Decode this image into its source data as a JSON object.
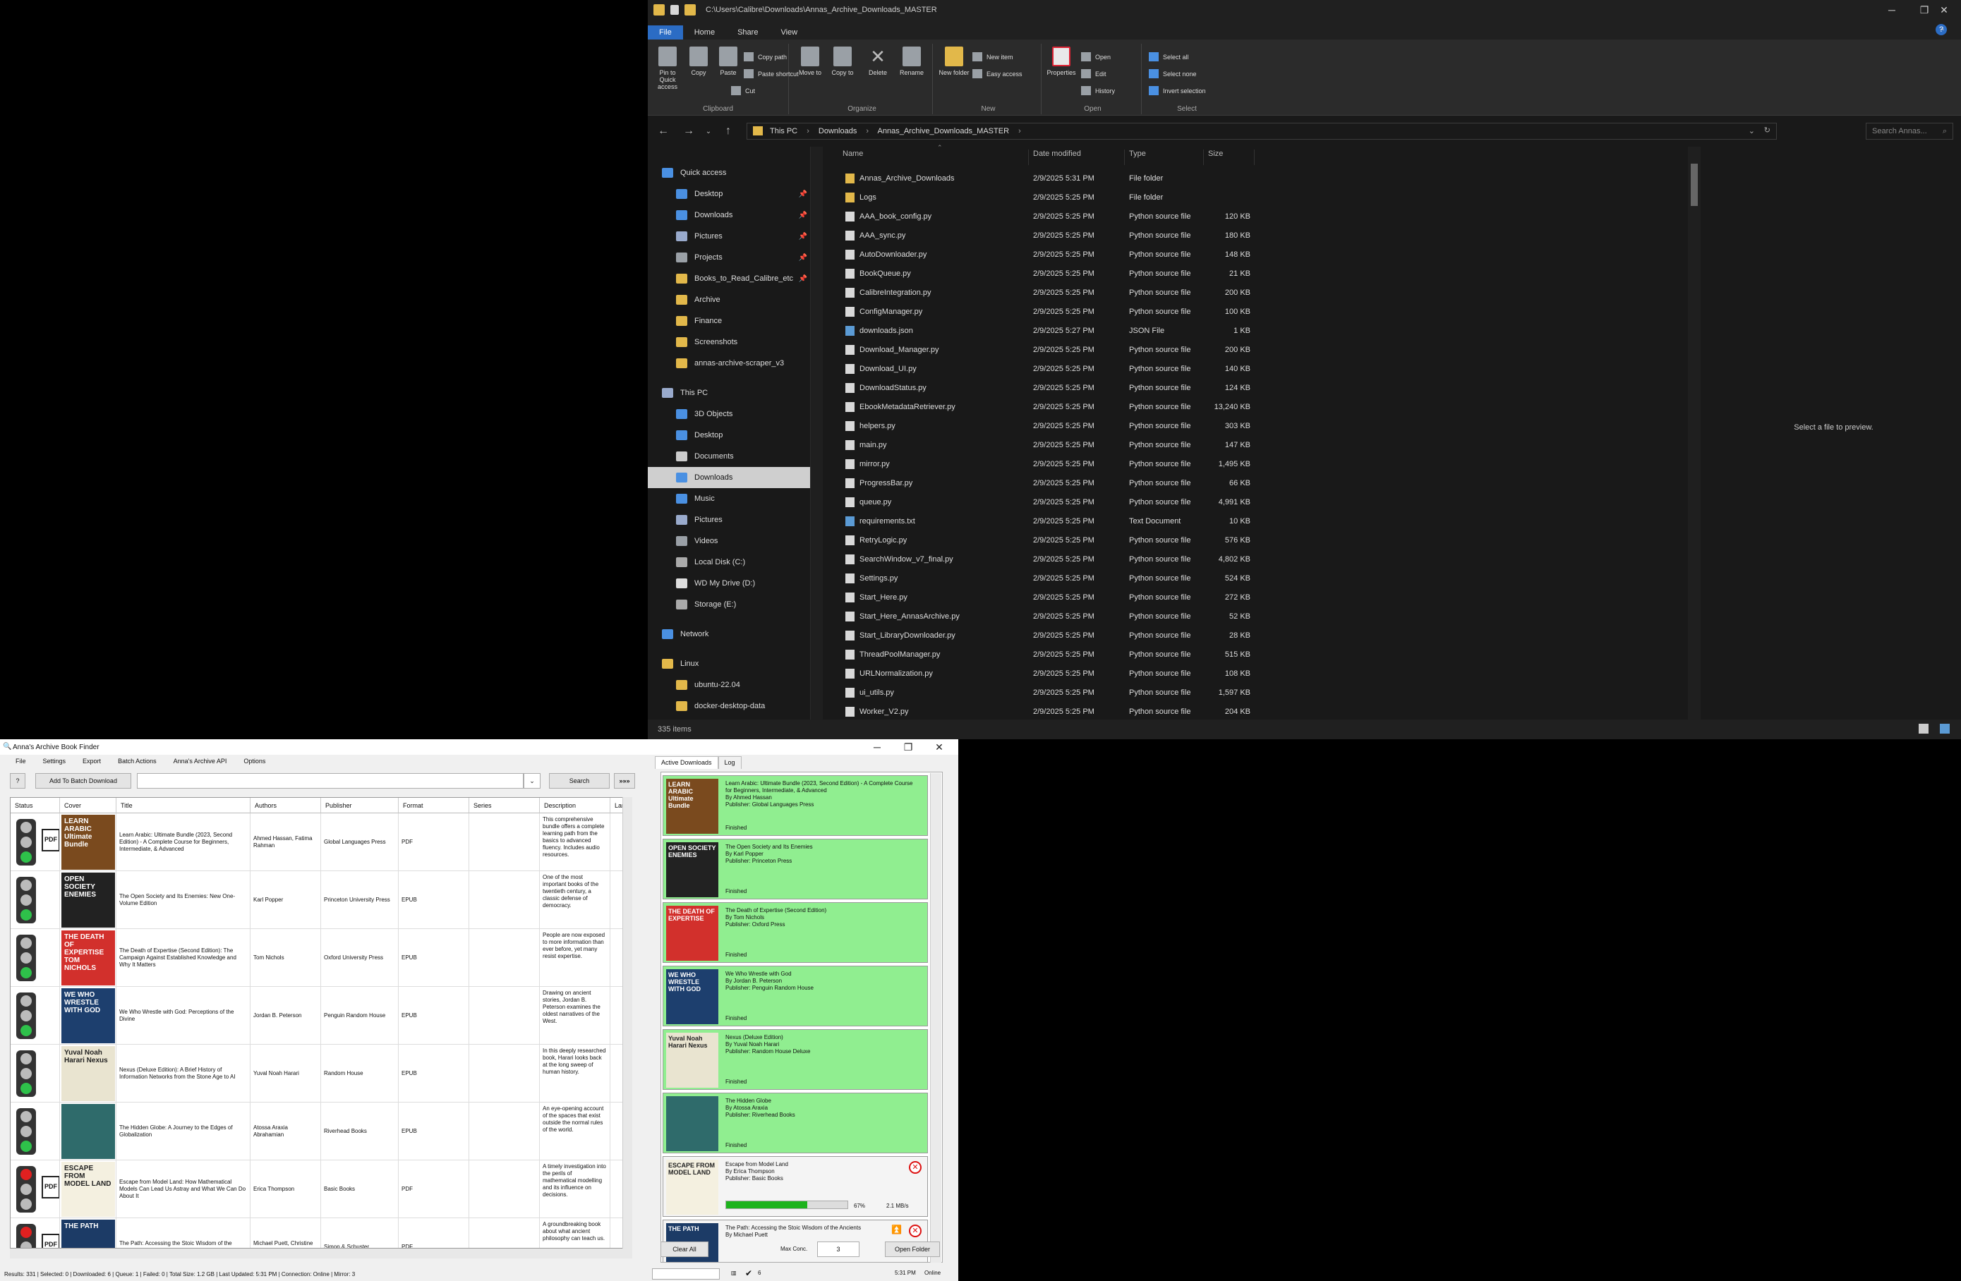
{
  "explorer": {
    "title": "C:\\Users\\Calibre\\Downloads\\Annas_Archive_Downloads_MASTER",
    "ribbon_tabs": [
      "File",
      "Home",
      "Share",
      "View"
    ],
    "ribbon_groups": {
      "clipboard": {
        "label": "Clipboard",
        "pin": "Pin to Quick access",
        "copy": "Copy",
        "paste": "Paste",
        "copy_path": "Copy path",
        "paste_shortcut": "Paste shortcut",
        "cut": "Cut"
      },
      "organize": {
        "label": "Organize",
        "move_to": "Move to",
        "copy_to": "Copy to",
        "delete": "Delete",
        "rename": "Rename"
      },
      "new": {
        "label": "New",
        "new_folder": "New folder",
        "new_item": "New item",
        "easy_access": "Easy access"
      },
      "open": {
        "label": "Open",
        "properties": "Properties",
        "open": "Open",
        "edit": "Edit",
        "history": "History"
      },
      "select": {
        "label": "Select",
        "select_all": "Select all",
        "select_none": "Select none",
        "invert": "Invert selection"
      }
    },
    "breadcrumb": [
      "This PC",
      "Downloads",
      "Annas_Archive_Downloads_MASTER"
    ],
    "search_placeholder": "Search Annas...",
    "columns": [
      "Name",
      "Date modified",
      "Type",
      "Size"
    ],
    "files": [
      {
        "name": "Annas_Archive_Downloads",
        "date": "2/9/2025 5:31 PM",
        "type": "File folder",
        "size": "",
        "icon": "folder"
      },
      {
        "name": "Logs",
        "date": "2/9/2025 5:25 PM",
        "type": "File folder",
        "size": "",
        "icon": "folder"
      },
      {
        "name": "AAA_book_config.py",
        "date": "2/9/2025 5:25 PM",
        "type": "Python source file",
        "size": "120 KB",
        "icon": "file"
      },
      {
        "name": "AAA_sync.py",
        "date": "2/9/2025 5:25 PM",
        "type": "Python source file",
        "size": "180 KB",
        "icon": "file"
      },
      {
        "name": "AutoDownloader.py",
        "date": "2/9/2025 5:25 PM",
        "type": "Python source file",
        "size": "148 KB",
        "icon": "file"
      },
      {
        "name": "BookQueue.py",
        "date": "2/9/2025 5:25 PM",
        "type": "Python source file",
        "size": "21 KB",
        "icon": "file"
      },
      {
        "name": "CalibreIntegration.py",
        "date": "2/9/2025 5:25 PM",
        "type": "Python source file",
        "size": "200 KB",
        "icon": "file"
      },
      {
        "name": "ConfigManager.py",
        "date": "2/9/2025 5:25 PM",
        "type": "Python source file",
        "size": "100 KB",
        "icon": "file"
      },
      {
        "name": "downloads.json",
        "date": "2/9/2025 5:27 PM",
        "type": "JSON File",
        "size": "1 KB",
        "icon": "blue"
      },
      {
        "name": "Download_Manager.py",
        "date": "2/9/2025 5:25 PM",
        "type": "Python source file",
        "size": "200 KB",
        "icon": "file"
      },
      {
        "name": "Download_UI.py",
        "date": "2/9/2025 5:25 PM",
        "type": "Python source file",
        "size": "140 KB",
        "icon": "file"
      },
      {
        "name": "DownloadStatus.py",
        "date": "2/9/2025 5:25 PM",
        "type": "Python source file",
        "size": "124 KB",
        "icon": "file"
      },
      {
        "name": "EbookMetadataRetriever.py",
        "date": "2/9/2025 5:25 PM",
        "type": "Python source file",
        "size": "13,240 KB",
        "icon": "file"
      },
      {
        "name": "helpers.py",
        "date": "2/9/2025 5:25 PM",
        "type": "Python source file",
        "size": "303 KB",
        "icon": "file"
      },
      {
        "name": "main.py",
        "date": "2/9/2025 5:25 PM",
        "type": "Python source file",
        "size": "147 KB",
        "icon": "file"
      },
      {
        "name": "mirror.py",
        "date": "2/9/2025 5:25 PM",
        "type": "Python source file",
        "size": "1,495 KB",
        "icon": "file"
      },
      {
        "name": "ProgressBar.py",
        "date": "2/9/2025 5:25 PM",
        "type": "Python source file",
        "size": "66 KB",
        "icon": "file"
      },
      {
        "name": "queue.py",
        "date": "2/9/2025 5:25 PM",
        "type": "Python source file",
        "size": "4,991 KB",
        "icon": "file"
      },
      {
        "name": "requirements.txt",
        "date": "2/9/2025 5:25 PM",
        "type": "Text Document",
        "size": "10 KB",
        "icon": "blue"
      },
      {
        "name": "RetryLogic.py",
        "date": "2/9/2025 5:25 PM",
        "type": "Python source file",
        "size": "576 KB",
        "icon": "file"
      },
      {
        "name": "SearchWindow_v7_final.py",
        "date": "2/9/2025 5:25 PM",
        "type": "Python source file",
        "size": "4,802 KB",
        "icon": "file"
      },
      {
        "name": "Settings.py",
        "date": "2/9/2025 5:25 PM",
        "type": "Python source file",
        "size": "524 KB",
        "icon": "file"
      },
      {
        "name": "Start_Here.py",
        "date": "2/9/2025 5:25 PM",
        "type": "Python source file",
        "size": "272 KB",
        "icon": "file"
      },
      {
        "name": "Start_Here_AnnasArchive.py",
        "date": "2/9/2025 5:25 PM",
        "type": "Python source file",
        "size": "52 KB",
        "icon": "file"
      },
      {
        "name": "Start_LibraryDownloader.py",
        "date": "2/9/2025 5:25 PM",
        "type": "Python source file",
        "size": "28 KB",
        "icon": "file"
      },
      {
        "name": "ThreadPoolManager.py",
        "date": "2/9/2025 5:25 PM",
        "type": "Python source file",
        "size": "515 KB",
        "icon": "file"
      },
      {
        "name": "URLNormalization.py",
        "date": "2/9/2025 5:25 PM",
        "type": "Python source file",
        "size": "108 KB",
        "icon": "file"
      },
      {
        "name": "ui_utils.py",
        "date": "2/9/2025 5:25 PM",
        "type": "Python source file",
        "size": "1,597 KB",
        "icon": "file"
      },
      {
        "name": "Worker_V2.py",
        "date": "2/9/2025 5:25 PM",
        "type": "Python source file",
        "size": "204 KB",
        "icon": "file"
      }
    ],
    "nav": {
      "quick_access": "Quick access",
      "quick_items": [
        "Desktop",
        "Downloads",
        "Pictures",
        "Projects",
        "Books_to_Read_Calibre_etc",
        "Archive",
        "Finance",
        "Screenshots",
        "annas-archive-scraper_v3"
      ],
      "this_pc": "This PC",
      "pc_items": [
        "3D Objects",
        "Desktop",
        "Documents",
        "Downloads",
        "Music",
        "Pictures",
        "Videos",
        "Local Disk (C:)",
        "WD My Drive (D:)",
        "Storage (E:)"
      ],
      "network": "Network",
      "linux": "Linux",
      "linux_items": [
        "ubuntu-22.04",
        "docker-desktop-data"
      ]
    },
    "preview_text": "Select a file to preview.",
    "status": "335 items"
  },
  "app": {
    "title": "Anna's Archive Book Finder",
    "menu": [
      "File",
      "Settings",
      "Export",
      "Batch Actions",
      "Anna's Archive API",
      "Options"
    ],
    "help_label": "?",
    "add_button": "Add To Batch Download",
    "search_value": "",
    "search_button": "Search",
    "more_button": "»»»",
    "columns": [
      "Status",
      "Cover",
      "Title",
      "Authors",
      "Publisher",
      "Format",
      "Series",
      "Description",
      "Lang"
    ],
    "rows": [
      {
        "title": "Learn Arabic: Ultimate Bundle (2023, Second Edition) - A Complete Course for Beginners, Intermediate, & Advanced",
        "authors": "Ahmed Hassan, Fatima Rahman",
        "publisher": "Global Languages Press",
        "format": "PDF",
        "series": "",
        "desc": "This comprehensive bundle offers a complete learning path from the basics to advanced fluency. Includes audio resources.",
        "cover": "LEARN ARABIC Ultimate Bundle",
        "cover_bg": "#7a4a1e",
        "lights": [
          "off",
          "off",
          "g"
        ],
        "pdf": true
      },
      {
        "title": "The Open Society and Its Enemies: New One-Volume Edition",
        "authors": "Karl Popper",
        "publisher": "Princeton University Press",
        "format": "EPUB",
        "series": "",
        "desc": "One of the most important books of the twentieth century, a classic defense of democracy.",
        "cover": "OPEN SOCIETY ENEMIES",
        "cover_bg": "#222222",
        "lights": [
          "off",
          "off",
          "g"
        ],
        "pdf": false
      },
      {
        "title": "The Death of Expertise (Second Edition): The Campaign Against Established Knowledge and Why It Matters",
        "authors": "Tom Nichols",
        "publisher": "Oxford University Press",
        "format": "EPUB",
        "series": "",
        "desc": "People are now exposed to more information than ever before, yet many resist expertise.",
        "cover": "THE DEATH OF EXPERTISE TOM NICHOLS",
        "cover_bg": "#d2302c",
        "lights": [
          "off",
          "off",
          "g"
        ],
        "pdf": false
      },
      {
        "title": "We Who Wrestle with God: Perceptions of the Divine",
        "authors": "Jordan B. Peterson",
        "publisher": "Penguin Random House",
        "format": "EPUB",
        "series": "",
        "desc": "Drawing on ancient stories, Jordan B. Peterson examines the oldest narratives of the West.",
        "cover": "WE WHO WRESTLE WITH GOD",
        "cover_bg": "#1d3f6e",
        "lights": [
          "off",
          "off",
          "g"
        ],
        "pdf": false
      },
      {
        "title": "Nexus (Deluxe Edition): A Brief History of Information Networks from the Stone Age to AI",
        "authors": "Yuval Noah Harari",
        "publisher": "Random House",
        "format": "EPUB",
        "series": "",
        "desc": "In this deeply researched book, Harari looks back at the long sweep of human history.",
        "cover": "Yuval Noah Harari Nexus",
        "cover_bg": "#e9e4d0",
        "lights": [
          "off",
          "off",
          "g"
        ],
        "pdf": false
      },
      {
        "title": "The Hidden Globe: A Journey to the Edges of Globalization",
        "authors": "Atossa Araxia Abrahamian",
        "publisher": "Riverhead Books",
        "format": "EPUB",
        "series": "",
        "desc": "An eye-opening account of the spaces that exist outside the normal rules of the world.",
        "cover": "",
        "cover_bg": "#2f6b6b",
        "lights": [
          "off",
          "off",
          "g"
        ],
        "pdf": false
      },
      {
        "title": "Escape from Model Land: How Mathematical Models Can Lead Us Astray and What We Can Do About It",
        "authors": "Erica Thompson",
        "publisher": "Basic Books",
        "format": "PDF",
        "series": "",
        "desc": "A timely investigation into the perils of mathematical modelling and its influence on decisions.",
        "cover": "ESCAPE FROM MODEL LAND",
        "cover_bg": "#f4f0e0",
        "lights": [
          "r",
          "off",
          "off"
        ],
        "pdf": true
      },
      {
        "title": "The Path: Accessing the Stoic Wisdom of the Ancients",
        "authors": "Michael Puett, Christine Gross-Loh",
        "publisher": "Simon & Schuster",
        "format": "PDF",
        "series": "",
        "desc": "A groundbreaking book about what ancient philosophy can teach us.",
        "cover": "THE PATH",
        "cover_bg": "#1c3b66",
        "lights": [
          "r",
          "off",
          "off"
        ],
        "pdf": true
      }
    ],
    "status": "Results: 331 | Selected: 0 | Downloaded: 6 | Queue: 1 | Failed: 0 | Total Size: 1.2 GB | Last Updated: 5:31 PM | Connection: Online | Mirror: 3"
  },
  "downloads": {
    "tabs": [
      "Active Downloads",
      "Log"
    ],
    "items": [
      {
        "title": "Learn Arabic: Ultimate Bundle (2023, Second Edition) - A Complete Course for Beginners, Intermediate, & Advanced",
        "by": "By Ahmed Hassan",
        "meta": "Publisher: Global Languages Press",
        "status": "Finished",
        "cover": "LEARN ARABIC Ultimate Bundle",
        "cover_bg": "#7a4a1e",
        "state": "ok"
      },
      {
        "title": "The Open Society and Its Enemies",
        "by": "By Karl Popper",
        "meta": "Publisher: Princeton Press",
        "status": "Finished",
        "cover": "OPEN SOCIETY ENEMIES",
        "cover_bg": "#222222",
        "state": "ok"
      },
      {
        "title": "The Death of Expertise (Second Edition)",
        "by": "By Tom Nichols",
        "meta": "Publisher: Oxford Press",
        "status": "Finished",
        "cover": "THE DEATH OF EXPERTISE",
        "cover_bg": "#d2302c",
        "state": "ok"
      },
      {
        "title": "We Who Wrestle with God",
        "by": "By Jordan B. Peterson",
        "meta": "Publisher: Penguin Random House",
        "status": "Finished",
        "cover": "WE WHO WRESTLE WITH GOD",
        "cover_bg": "#1d3f6e",
        "state": "ok"
      },
      {
        "title": "Nexus (Deluxe Edition)",
        "by": "By Yuval Noah Harari",
        "meta": "Publisher: Random House Deluxe",
        "status": "Finished",
        "cover": "Yuval Noah Harari Nexus",
        "cover_bg": "#e9e4d0",
        "state": "ok"
      },
      {
        "title": "The Hidden Globe",
        "by": "By Atossa Araxia",
        "meta": "Publisher: Riverhead Books",
        "status": "Finished",
        "cover": "",
        "cover_bg": "#2f6b6b",
        "state": "ok"
      },
      {
        "title": "Escape from Model Land",
        "by": "By Erica Thompson",
        "meta": "Publisher: Basic Books",
        "status": "67%",
        "progress": 0.67,
        "speed": "2.1 MB/s",
        "cover": "ESCAPE FROM MODEL LAND",
        "cover_bg": "#f4f0e0",
        "state": "pending"
      },
      {
        "title": "The Path: Accessing the Stoic Wisdom of the Ancients",
        "by": "By Michael Puett",
        "meta": "",
        "status": "",
        "cover": "THE PATH",
        "cover_bg": "#1c3b66",
        "state": "pending"
      }
    ],
    "clear_button": "Clear All",
    "limit_label": "Max Conc.",
    "limit_value": "3",
    "open_button": "Open Folder",
    "footer_left": "",
    "footer_count": "6",
    "footer_right_1": "5:31 PM",
    "footer_right_2": "Online"
  }
}
